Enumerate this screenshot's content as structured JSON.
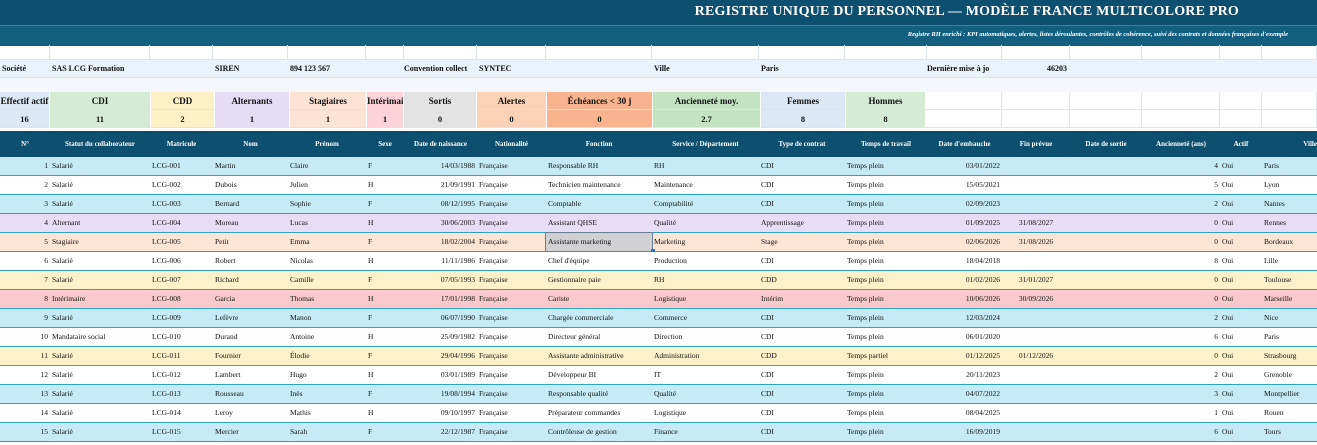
{
  "title": "REGISTRE UNIQUE DU PERSONNEL — MODÈLE FRANCE MULTICOLORE PRO",
  "subtitle": "Registre RH enrichi : KPI automatiques, alertes, listes déroulantes, contrôles de cohérence, suivi des contrats et données françaises d'exemple",
  "info": {
    "societe_label": "Société",
    "societe_value": "SAS LCG Formation",
    "siren_label": "SIREN",
    "siren_value": "894 123 567",
    "convention_label": "Convention collect",
    "convention_value": "SYNTEC",
    "ville_label": "Ville",
    "ville_value": "Paris",
    "maj_label": "Dernière mise à jo",
    "maj_value": "46203"
  },
  "kpis": [
    {
      "label": "Effectif actif",
      "value": "16",
      "bg": "#dbe9f6"
    },
    {
      "label": "CDI",
      "value": "11",
      "bg": "#d5ecd4"
    },
    {
      "label": "CDD",
      "value": "2",
      "bg": "#fdf0c4"
    },
    {
      "label": "Alternants",
      "value": "1",
      "bg": "#e5dcf5"
    },
    {
      "label": "Stagiaires",
      "value": "1",
      "bg": "#fde3d4"
    },
    {
      "label": "Intérimaires",
      "value": "1",
      "bg": "#fbd3d8"
    },
    {
      "label": "Sortis",
      "value": "0",
      "bg": "#e3e3e3"
    },
    {
      "label": "Alertes",
      "value": "0",
      "bg": "#fcd2b7"
    },
    {
      "label": "Échéances < 30 j",
      "value": "0",
      "bg": "#f8b48e"
    },
    {
      "label": "Ancienneté moy.",
      "value": "2.7",
      "bg": "#c3e3c1"
    },
    {
      "label": "Femmes",
      "value": "8",
      "bg": "#dbe9f6"
    },
    {
      "label": "Hommes",
      "value": "8",
      "bg": "#d5ecd4"
    }
  ],
  "columns": [
    "N°",
    "Statut du collaborateur",
    "Matricule",
    "Nom",
    "Prénom",
    "Sexe",
    "Date de naissance",
    "Nationalité",
    "Fonction",
    "Service / Département",
    "Type de contrat",
    "Temps de travail",
    "Date d'embauche",
    "Fin prévue",
    "Date de sortie",
    "Ancienneté (ans)",
    "Actif",
    "Ville"
  ],
  "rows": [
    {
      "n": "1",
      "statut": "Salarié",
      "matricule": "LCG-001",
      "nom": "Martin",
      "prenom": "Claire",
      "sexe": "F",
      "naissance": "14/03/1988",
      "nationalite": "Française",
      "fonction": "Responsable RH",
      "service": "RH",
      "contrat": "CDI",
      "temps": "Temps plein",
      "embauche": "03/01/2022",
      "fin": "",
      "sortie": "",
      "anciennete": "4",
      "actif": "Oui",
      "ville": "Paris",
      "bg": "#c7ebf6"
    },
    {
      "n": "2",
      "statut": "Salarié",
      "matricule": "LCG-002",
      "nom": "Dubois",
      "prenom": "Julien",
      "sexe": "H",
      "naissance": "21/09/1991",
      "nationalite": "Française",
      "fonction": "Technicien maintenance",
      "service": "Maintenance",
      "contrat": "CDI",
      "temps": "Temps plein",
      "embauche": "15/05/2021",
      "fin": "",
      "sortie": "",
      "anciennete": "5",
      "actif": "Oui",
      "ville": "Lyon",
      "bg": "#ffffff"
    },
    {
      "n": "3",
      "statut": "Salarié",
      "matricule": "LCG-003",
      "nom": "Bernard",
      "prenom": "Sophie",
      "sexe": "F",
      "naissance": "08/12/1995",
      "nationalite": "Française",
      "fonction": "Comptable",
      "service": "Comptabilité",
      "contrat": "CDI",
      "temps": "Temps plein",
      "embauche": "02/09/2023",
      "fin": "",
      "sortie": "",
      "anciennete": "2",
      "actif": "Oui",
      "ville": "Nantes",
      "bg": "#c7ebf6"
    },
    {
      "n": "4",
      "statut": "Alternant",
      "matricule": "LCG-004",
      "nom": "Moreau",
      "prenom": "Lucas",
      "sexe": "H",
      "naissance": "30/06/2003",
      "nationalite": "Française",
      "fonction": "Assistant QHSE",
      "service": "Qualité",
      "contrat": "Apprentissage",
      "temps": "Temps plein",
      "embauche": "01/09/2025",
      "fin": "31/08/2027",
      "sortie": "",
      "anciennete": "0",
      "actif": "Oui",
      "ville": "Rennes",
      "bg": "#e8ddf6"
    },
    {
      "n": "5",
      "statut": "Stagiaire",
      "matricule": "LCG-005",
      "nom": "Petit",
      "prenom": "Emma",
      "sexe": "F",
      "naissance": "18/02/2004",
      "nationalite": "Française",
      "fonction": "Assistante marketing",
      "service": "Marketing",
      "contrat": "Stage",
      "temps": "Temps plein",
      "embauche": "02/06/2026",
      "fin": "31/08/2026",
      "sortie": "",
      "anciennete": "0",
      "actif": "Oui",
      "ville": "Bordeaux",
      "bg": "#fde5d6"
    },
    {
      "n": "6",
      "statut": "Salarié",
      "matricule": "LCG-006",
      "nom": "Robert",
      "prenom": "Nicolas",
      "sexe": "H",
      "naissance": "11/11/1986",
      "nationalite": "Française",
      "fonction": "Chef d'équipe",
      "service": "Production",
      "contrat": "CDI",
      "temps": "Temps plein",
      "embauche": "18/04/2018",
      "fin": "",
      "sortie": "",
      "anciennete": "8",
      "actif": "Oui",
      "ville": "Lille",
      "bg": "#ffffff"
    },
    {
      "n": "7",
      "statut": "Salarié",
      "matricule": "LCG-007",
      "nom": "Richard",
      "prenom": "Camille",
      "sexe": "F",
      "naissance": "07/05/1993",
      "nationalite": "Française",
      "fonction": "Gestionnaire paie",
      "service": "RH",
      "contrat": "CDD",
      "temps": "Temps plein",
      "embauche": "01/02/2026",
      "fin": "31/01/2027",
      "sortie": "",
      "anciennete": "0",
      "actif": "Oui",
      "ville": "Toulouse",
      "bg": "#fdf1c9"
    },
    {
      "n": "8",
      "statut": "Intérimaire",
      "matricule": "LCG-008",
      "nom": "Garcia",
      "prenom": "Thomas",
      "sexe": "H",
      "naissance": "17/01/1998",
      "nationalite": "Française",
      "fonction": "Cariste",
      "service": "Logistique",
      "contrat": "Intérim",
      "temps": "Temps plein",
      "embauche": "10/06/2026",
      "fin": "30/09/2026",
      "sortie": "",
      "anciennete": "0",
      "actif": "Oui",
      "ville": "Marseille",
      "bg": "#f9c9ce"
    },
    {
      "n": "9",
      "statut": "Salarié",
      "matricule": "LCG-009",
      "nom": "Lefèvre",
      "prenom": "Manon",
      "sexe": "F",
      "naissance": "06/07/1990",
      "nationalite": "Française",
      "fonction": "Chargée commerciale",
      "service": "Commerce",
      "contrat": "CDI",
      "temps": "Temps plein",
      "embauche": "12/03/2024",
      "fin": "",
      "sortie": "",
      "anciennete": "2",
      "actif": "Oui",
      "ville": "Nice",
      "bg": "#c7ebf6"
    },
    {
      "n": "10",
      "statut": "Mandataire social",
      "matricule": "LCG-010",
      "nom": "Durand",
      "prenom": "Antoine",
      "sexe": "H",
      "naissance": "25/09/1982",
      "nationalite": "Française",
      "fonction": "Directeur général",
      "service": "Direction",
      "contrat": "CDI",
      "temps": "Temps plein",
      "embauche": "06/01/2020",
      "fin": "",
      "sortie": "",
      "anciennete": "6",
      "actif": "Oui",
      "ville": "Paris",
      "bg": "#ffffff"
    },
    {
      "n": "11",
      "statut": "Salarié",
      "matricule": "LCG-011",
      "nom": "Fournier",
      "prenom": "Élodie",
      "sexe": "F",
      "naissance": "29/04/1996",
      "nationalite": "Française",
      "fonction": "Assistante administrative",
      "service": "Administration",
      "contrat": "CDD",
      "temps": "Temps partiel",
      "embauche": "01/12/2025",
      "fin": "01/12/2026",
      "sortie": "",
      "anciennete": "0",
      "actif": "Oui",
      "ville": "Strasbourg",
      "bg": "#fdf1c9"
    },
    {
      "n": "12",
      "statut": "Salarié",
      "matricule": "LCG-012",
      "nom": "Lambert",
      "prenom": "Hugo",
      "sexe": "H",
      "naissance": "03/01/1989",
      "nationalite": "Française",
      "fonction": "Développeur BI",
      "service": "IT",
      "contrat": "CDI",
      "temps": "Temps plein",
      "embauche": "20/11/2023",
      "fin": "",
      "sortie": "",
      "anciennete": "2",
      "actif": "Oui",
      "ville": "Grenoble",
      "bg": "#ffffff"
    },
    {
      "n": "13",
      "statut": "Salarié",
      "matricule": "LCG-013",
      "nom": "Rousseau",
      "prenom": "Inès",
      "sexe": "F",
      "naissance": "19/08/1994",
      "nationalite": "Française",
      "fonction": "Responsable qualité",
      "service": "Qualité",
      "contrat": "CDI",
      "temps": "Temps plein",
      "embauche": "04/07/2022",
      "fin": "",
      "sortie": "",
      "anciennete": "3",
      "actif": "Oui",
      "ville": "Montpellier",
      "bg": "#c7ebf6"
    },
    {
      "n": "14",
      "statut": "Salarié",
      "matricule": "LCG-014",
      "nom": "Leroy",
      "prenom": "Mathis",
      "sexe": "H",
      "naissance": "09/10/1997",
      "nationalite": "Française",
      "fonction": "Préparateur commandes",
      "service": "Logistique",
      "contrat": "CDI",
      "temps": "Temps plein",
      "embauche": "08/04/2025",
      "fin": "",
      "sortie": "",
      "anciennete": "1",
      "actif": "Oui",
      "ville": "Rouen",
      "bg": "#ffffff"
    },
    {
      "n": "15",
      "statut": "Salarié",
      "matricule": "LCG-015",
      "nom": "Mercier",
      "prenom": "Sarah",
      "sexe": "F",
      "naissance": "22/12/1987",
      "nationalite": "Française",
      "fonction": "Contrôleuse de gestion",
      "service": "Finance",
      "contrat": "CDI",
      "temps": "Temps plein",
      "embauche": "16/09/2019",
      "fin": "",
      "sortie": "",
      "anciennete": "6",
      "actif": "Oui",
      "ville": "Tours",
      "bg": "#c7ebf6"
    }
  ],
  "colors": {
    "header_bg": "#0d4f6e",
    "subtitle_bg": "#125f80",
    "row_border": "#2ea3c1"
  }
}
